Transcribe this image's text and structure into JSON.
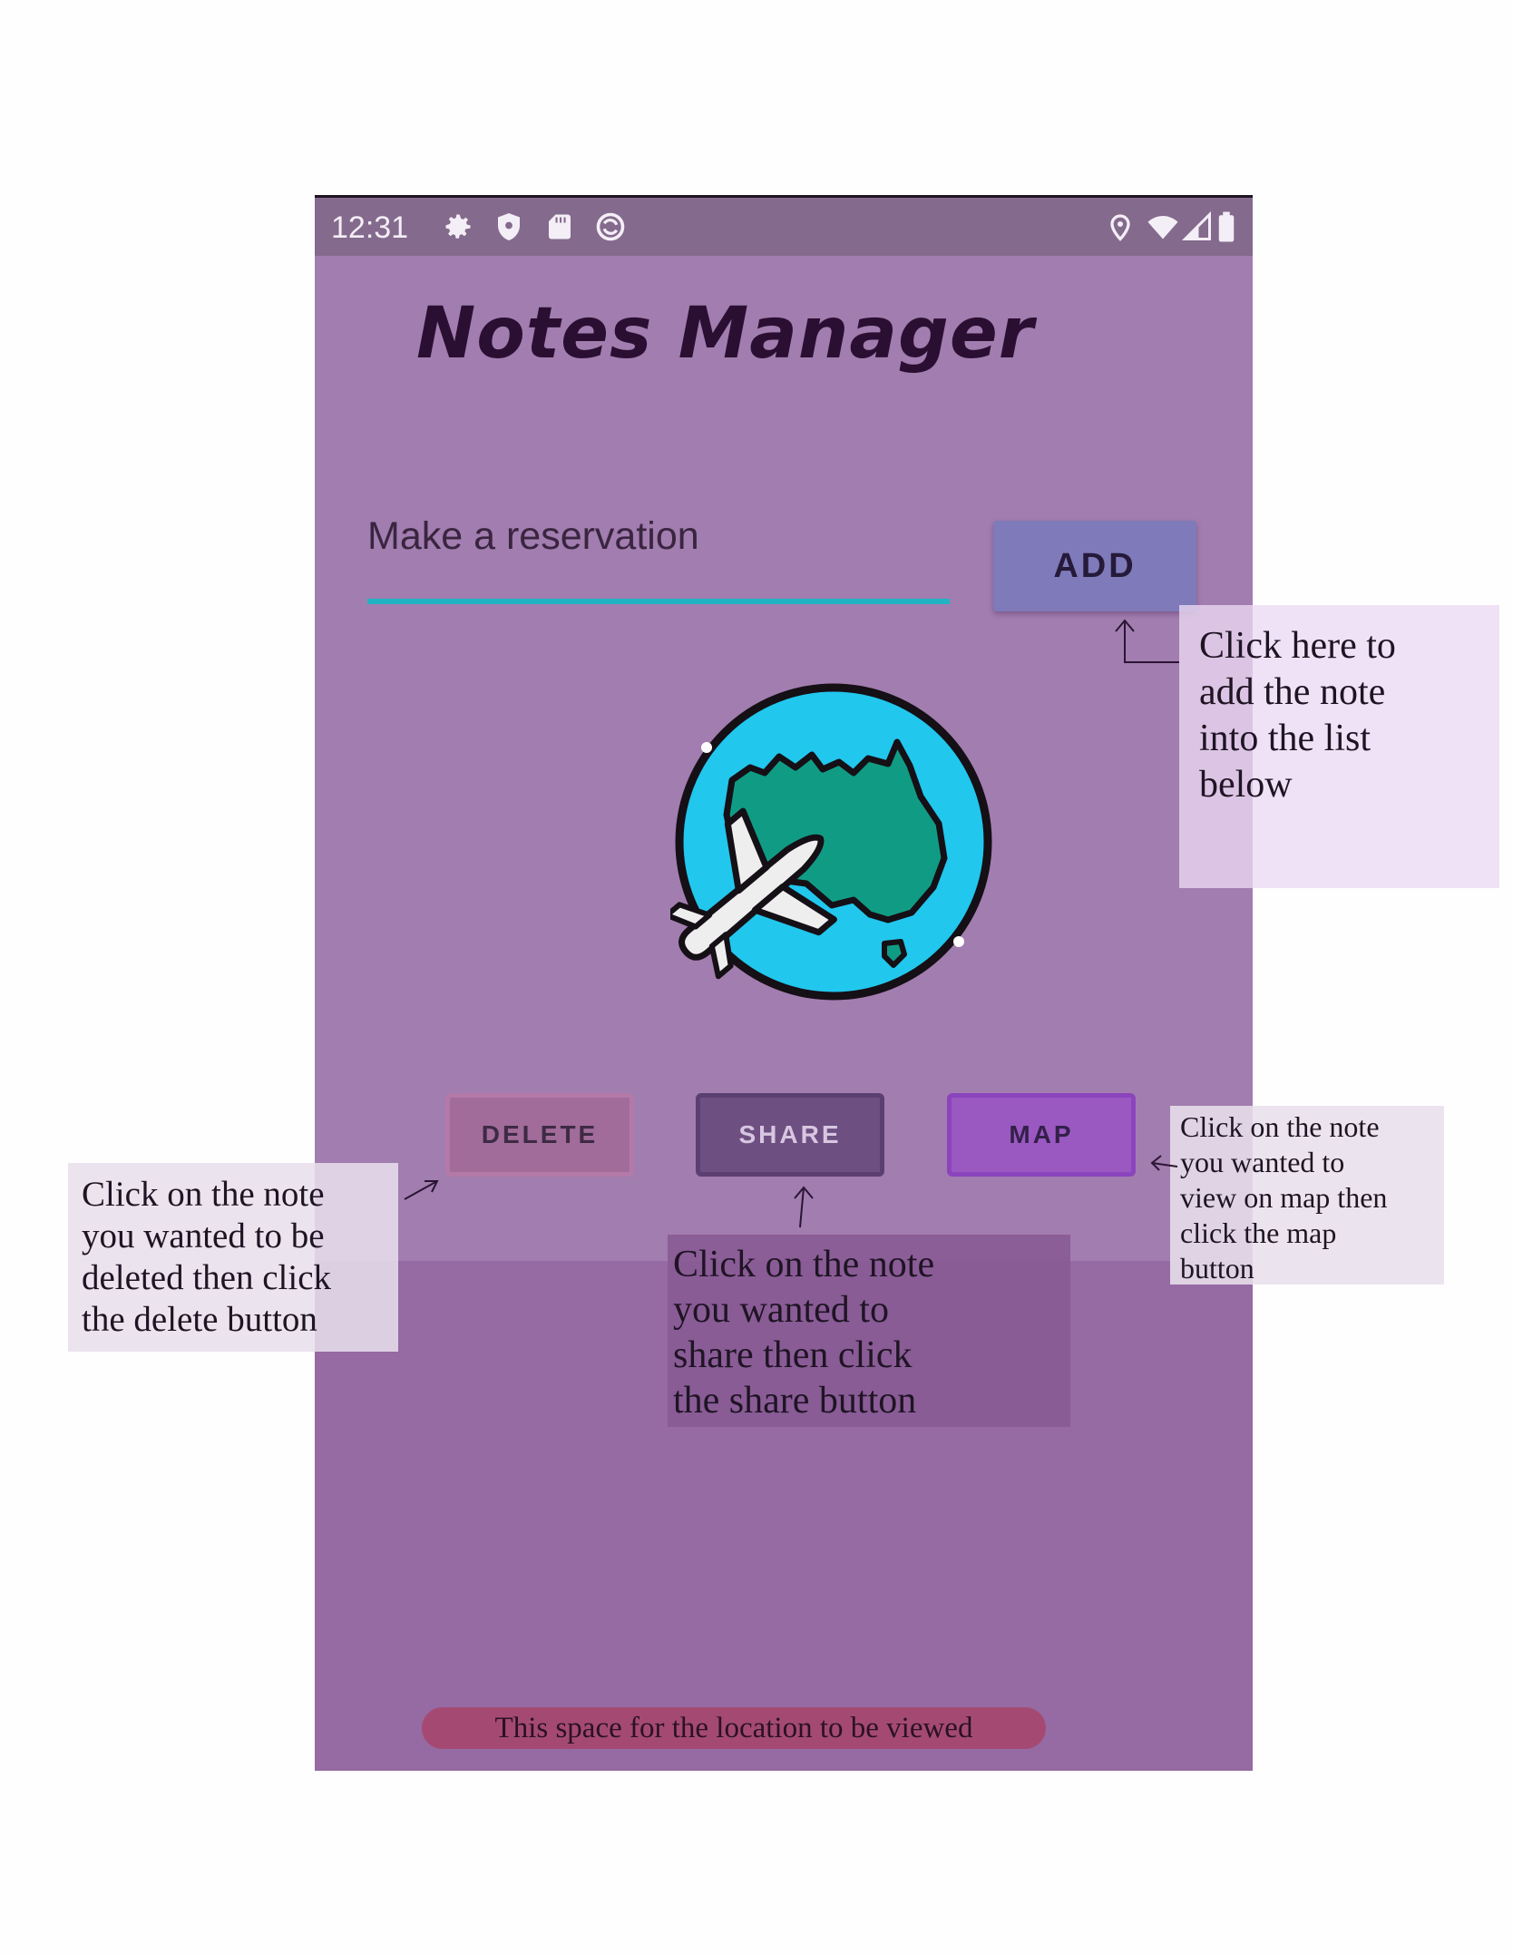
{
  "status_bar": {
    "time": "12:31",
    "left_icons": [
      "gear-icon",
      "shield-icon",
      "sd-card-icon",
      "sync-icon"
    ],
    "right_icons": [
      "location-pin-icon",
      "wifi-icon",
      "signal-icon",
      "battery-icon"
    ]
  },
  "app": {
    "title": "Notes Manager",
    "input": {
      "value": "Make a reservation"
    },
    "add_label": "ADD",
    "image": "globe-airplane-icon",
    "buttons": {
      "delete_label": "DELETE",
      "share_label": "SHARE",
      "map_label": "MAP"
    },
    "location_text": "This space for the location to be viewed"
  },
  "annotations": {
    "add": [
      "Click here to",
      "add the note",
      "into the list",
      "below"
    ],
    "delete": [
      "Click on the note",
      "you wanted to be",
      "deleted then click",
      "the delete button"
    ],
    "share": [
      "Click on the note",
      "you wanted to",
      "share then click",
      "the share button"
    ],
    "map": [
      "Click on the note",
      "you wanted to",
      "view on map then",
      "click the map",
      "button"
    ]
  },
  "colors": {
    "app_background": "#a27daf",
    "status_bar": "#846a8d",
    "input_underline": "#21b3c4",
    "add_button": "#7f7ab9",
    "delete_button": "#a16c9a",
    "share_button": "#6e4f82",
    "map_button": "#9a59c1",
    "location_pill": "#a44a72"
  }
}
